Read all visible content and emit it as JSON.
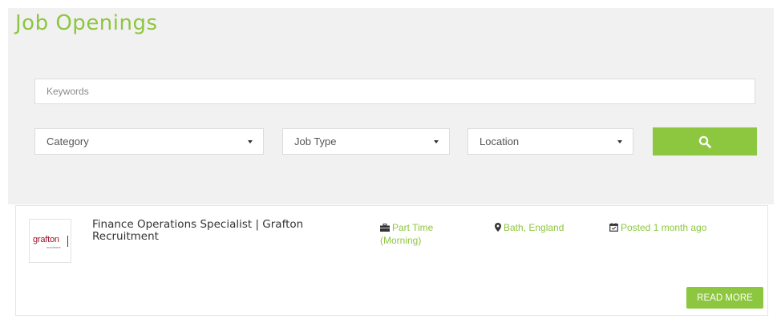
{
  "page": {
    "title": "Job Openings"
  },
  "search": {
    "keywords_placeholder": "Keywords",
    "filters": [
      {
        "label": "Category"
      },
      {
        "label": "Job Type"
      },
      {
        "label": "Location"
      }
    ],
    "button_icon": "search-icon"
  },
  "job": {
    "logo_text": "grafton",
    "logo_subtext": "recruitment",
    "title": "Finance Operations Specialist | Grafton Recruitment",
    "type": "Part Time (Morning)",
    "type_icon": "briefcase-icon",
    "location": "Bath, England",
    "location_icon": "map-marker-icon",
    "posted": "Posted 1 month ago",
    "posted_icon": "calendar-icon",
    "read_more_label": "READ MORE"
  },
  "colors": {
    "accent": "#8dc63f",
    "panel_bg": "#f1f1f1",
    "logo_red": "#a0112b"
  }
}
